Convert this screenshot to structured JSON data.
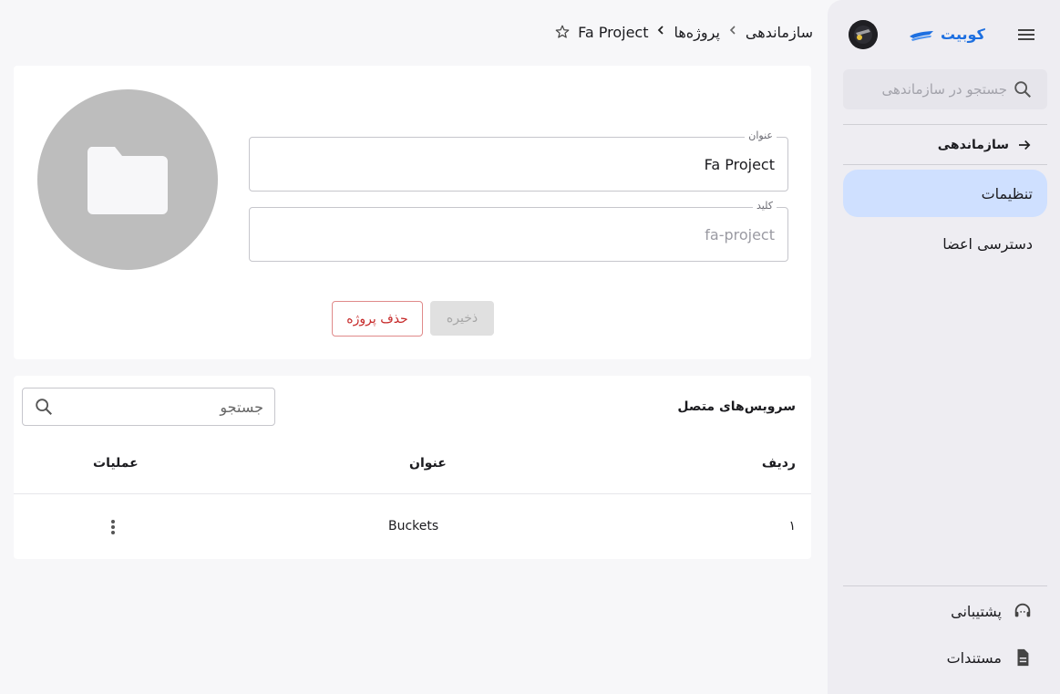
{
  "sidebar": {
    "brand": "کوبیت",
    "search_placeholder": "جستجو در سازماندهی",
    "back_label": "سازماندهی",
    "items": [
      {
        "label": "تنظیمات",
        "active": true
      },
      {
        "label": "دسترسی اعضا",
        "active": false
      }
    ],
    "bottom": [
      {
        "label": "پشتیبانی",
        "icon": "headset-icon"
      },
      {
        "label": "مستندات",
        "icon": "document-icon"
      }
    ]
  },
  "breadcrumb": {
    "items": [
      "سازماندهی",
      "پروژه‌ها",
      "Fa Project"
    ]
  },
  "project": {
    "title_label": "عنوان",
    "title_value": "Fa Project",
    "key_label": "کلید",
    "key_value": "fa-project",
    "save_label": "ذخیره",
    "delete_label": "حذف پروژه"
  },
  "services": {
    "title": "سرویس‌های متصل",
    "search_placeholder": "جستجو",
    "columns": [
      "ردیف",
      "عنوان",
      "عملیات"
    ],
    "rows": [
      {
        "index": "۱",
        "title": "Buckets"
      }
    ]
  },
  "colors": {
    "accent": "#1d6fe0",
    "active_nav": "#cfe0ff",
    "danger": "#c62828",
    "sidebar_bg": "#eeedf2"
  }
}
